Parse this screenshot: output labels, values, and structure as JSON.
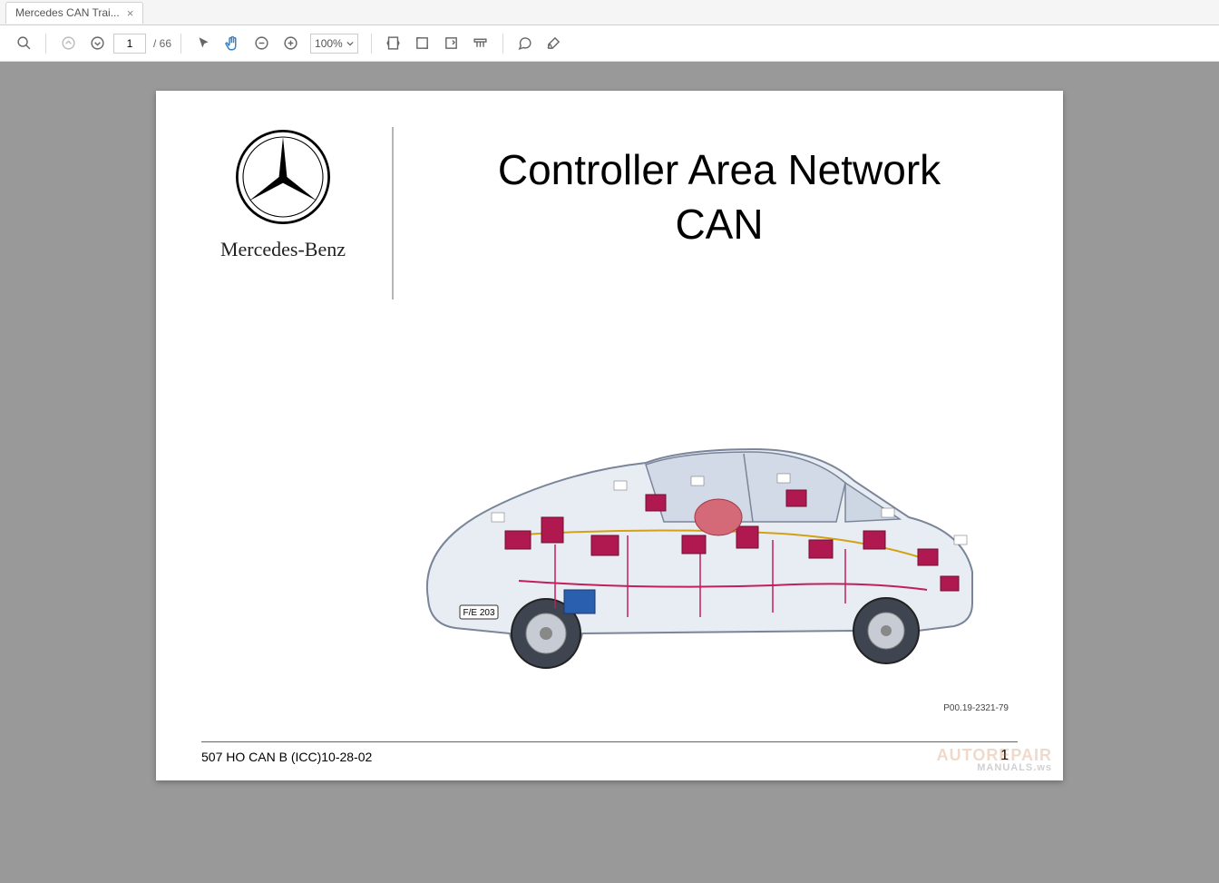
{
  "tab": {
    "title": "Mercedes CAN Trai..."
  },
  "toolbar": {
    "current_page": "1",
    "total_pages": "66",
    "zoom": "100%"
  },
  "document": {
    "brand": "Mercedes-Benz",
    "title_line1": "Controller Area Network",
    "title_line2": "CAN",
    "car_plate": "F/E 203",
    "figure_code": "P00.19-2321-79",
    "footer_left": "507 HO CAN B (ICC)10-28-02",
    "page_number": "1"
  },
  "watermark": {
    "line1": "AUTOREPAIR",
    "line2": "MANUALS.ws"
  }
}
